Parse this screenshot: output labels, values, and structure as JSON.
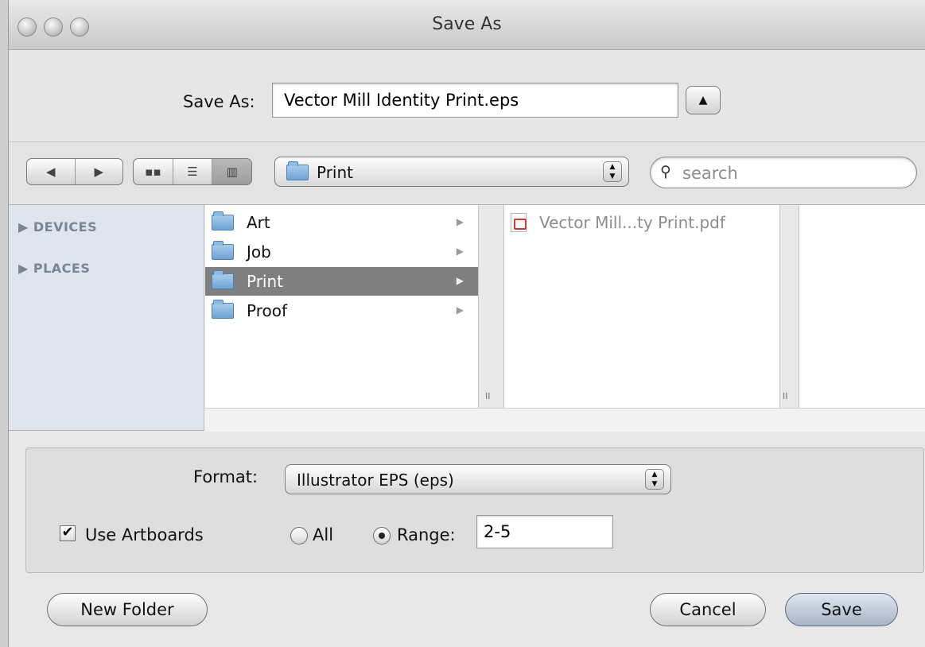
{
  "window": {
    "title": "Save As"
  },
  "saveas": {
    "label": "Save As:",
    "value": "Vector Mill Identity Print.eps"
  },
  "toolbar": {
    "nav_back_icon": "◀",
    "nav_forward_icon": "▶",
    "location": "Print",
    "search_placeholder": "search",
    "search_icon": "🔍"
  },
  "sidebar": {
    "devices": "▶ DEVICES",
    "places": "▶ PLACES"
  },
  "column1": {
    "items": [
      {
        "label": "Art"
      },
      {
        "label": "Job"
      },
      {
        "label": "Print",
        "selected": true
      },
      {
        "label": "Proof"
      }
    ]
  },
  "column2": {
    "items": [
      {
        "label": "Vector Mill...ty Print.pdf"
      }
    ]
  },
  "options": {
    "format_label": "Format:",
    "format_value": "Illustrator EPS (eps)",
    "use_artboards_label": "Use Artboards",
    "use_artboards_checked": true,
    "all_label": "All",
    "range_label": "Range:",
    "range_value": "2-5"
  },
  "buttons": {
    "new_folder": "New Folder",
    "cancel": "Cancel",
    "save": "Save"
  }
}
